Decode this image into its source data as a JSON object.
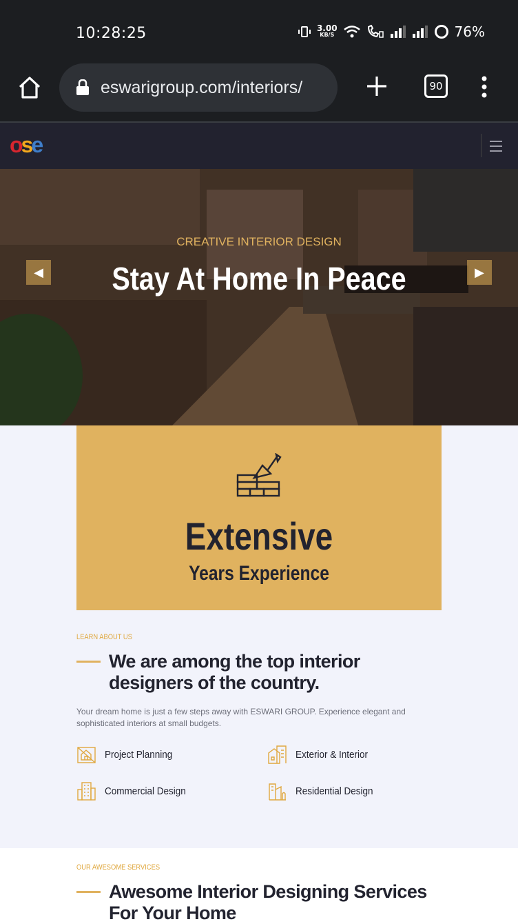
{
  "status_bar": {
    "time": "10:28:25",
    "net_speed_value": "3.00",
    "net_speed_unit": "KB/S",
    "battery": "76%"
  },
  "browser": {
    "url": "eswarigroup.com/interiors/",
    "tab_count": "90"
  },
  "site": {
    "logo_letters": [
      "o",
      "s",
      "e"
    ]
  },
  "hero": {
    "subtitle": "CREATIVE INTERIOR DESIGN",
    "title": "Stay At Home In Peace"
  },
  "experience": {
    "title": "Extensive",
    "subtitle": "Years Experience"
  },
  "about": {
    "eyebrow": "LEARN ABOUT US",
    "heading": "We are among the top interior designers of the country.",
    "description": "Your dream home is just a few steps away with ESWARI GROUP. Experience elegant and sophisticated interiors at small budgets.",
    "features": [
      {
        "label": "Project Planning",
        "icon": "blueprint-icon"
      },
      {
        "label": "Exterior & Interior",
        "icon": "building-icon"
      },
      {
        "label": "Commercial Design",
        "icon": "office-icon"
      },
      {
        "label": "Residential Design",
        "icon": "residential-icon"
      }
    ]
  },
  "services": {
    "eyebrow": "OUR AWESOME SERVICES",
    "heading": "Awesome Interior Designing Services For Your Home"
  },
  "colors": {
    "accent": "#e0b25f",
    "dark": "#22232f",
    "page_bg": "#f2f3fb"
  }
}
